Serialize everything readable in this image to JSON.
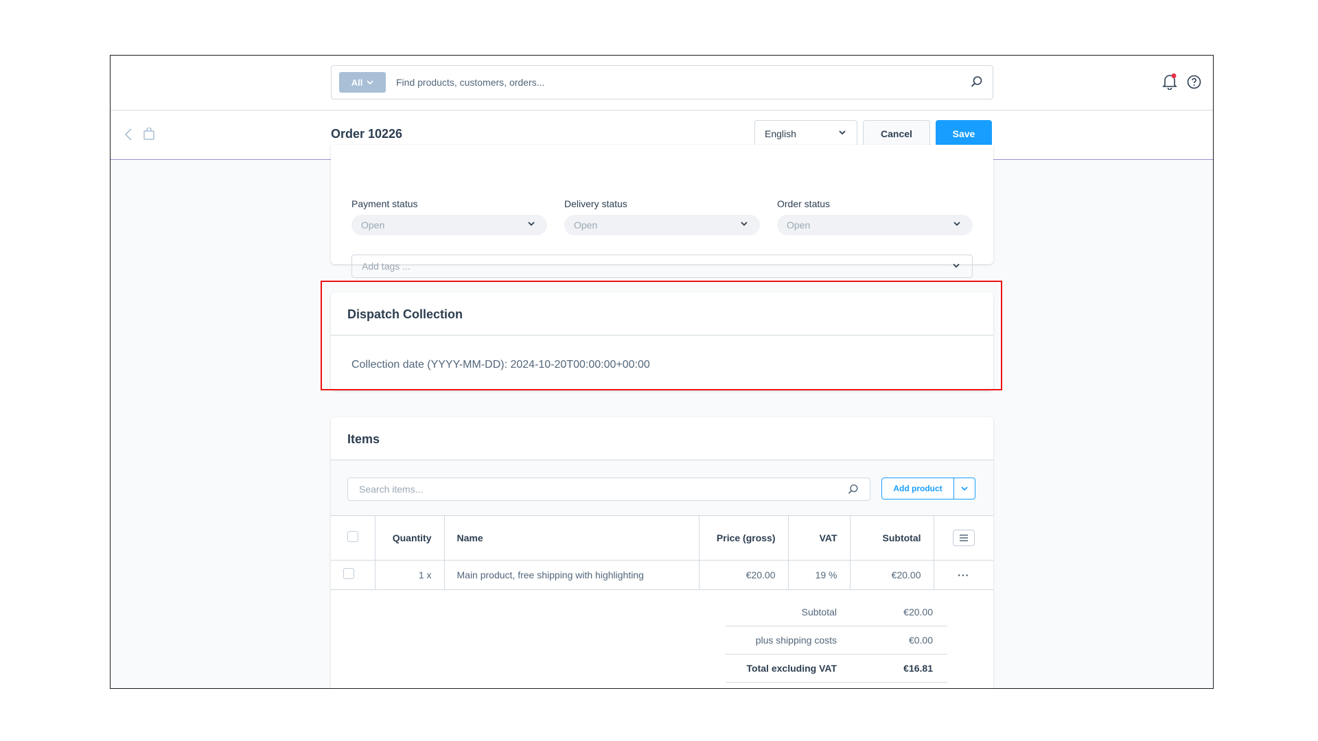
{
  "topbar": {
    "search_type": "All",
    "search_placeholder": "Find products, customers, orders..."
  },
  "header": {
    "title": "Order 10226",
    "language": "English",
    "cancel_label": "Cancel",
    "save_label": "Save"
  },
  "status": {
    "payment": {
      "label": "Payment status",
      "value": "Open"
    },
    "delivery": {
      "label": "Delivery status",
      "value": "Open"
    },
    "order": {
      "label": "Order status",
      "value": "Open"
    },
    "tags_placeholder": "Add tags ..."
  },
  "dispatch": {
    "title": "Dispatch Collection",
    "collection_date": "Collection date (YYYY-MM-DD): 2024-10-20T00:00:00+00:00"
  },
  "items": {
    "title": "Items",
    "search_placeholder": "Search items...",
    "add_product_label": "Add product",
    "columns": {
      "quantity": "Quantity",
      "name": "Name",
      "price": "Price (gross)",
      "vat": "VAT",
      "subtotal": "Subtotal"
    },
    "rows": [
      {
        "quantity": "1 x",
        "name": "Main product, free shipping with highlighting",
        "price": "€20.00",
        "vat": "19 %",
        "subtotal": "€20.00"
      }
    ],
    "summary": [
      {
        "label": "Subtotal",
        "value": "€20.00"
      },
      {
        "label": "plus shipping costs",
        "value": "€0.00"
      },
      {
        "label": "Total excluding VAT",
        "value": "€16.81"
      }
    ]
  },
  "colors": {
    "accent": "#189eff",
    "highlight": "#ee1111",
    "notification_dot": "#e8304a"
  }
}
